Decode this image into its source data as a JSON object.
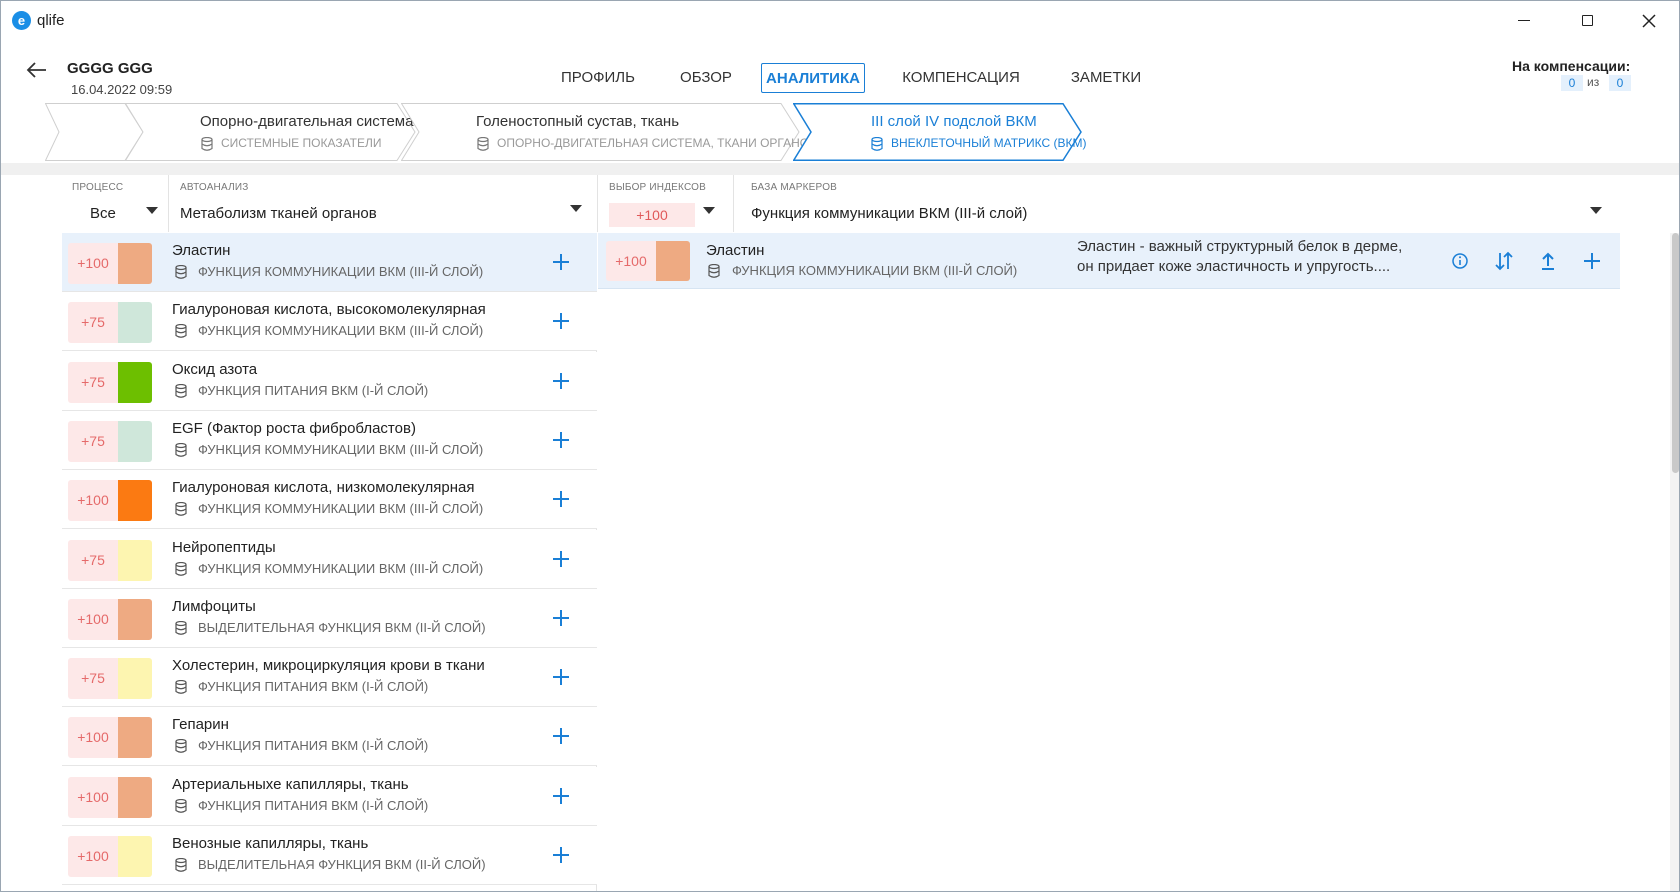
{
  "app": {
    "title": "qlife",
    "logo_glyph": "e"
  },
  "header": {
    "patient_name": "GGGG GGG",
    "patient_date": "16.04.2022 09:59",
    "tabs": [
      {
        "label": "ПРОФИЛЬ"
      },
      {
        "label": "ОБЗОР"
      },
      {
        "label": "АНАЛИТИКА",
        "active": true
      },
      {
        "label": "КОМПЕНСАЦИЯ"
      },
      {
        "label": "ЗАМЕТКИ"
      }
    ],
    "compensation": {
      "label": "На компенсации:",
      "current": "0",
      "of": "из",
      "total": "0"
    }
  },
  "breadcrumbs": [
    {
      "title": "",
      "subtitle": ""
    },
    {
      "title": "Опорно-двигательная система",
      "subtitle": "СИСТЕМНЫЕ ПОКАЗАТЕЛИ"
    },
    {
      "title": "Голеностопный сустав, ткань",
      "subtitle": "ОПОРНО-ДВИГАТЕЛЬНАЯ СИСТЕМА, ТКАНИ ОРГАНОВ"
    },
    {
      "title": "III слой IV подслой ВКМ",
      "subtitle": "ВНЕКЛЕТОЧНЫЙ МАТРИКС (ВКМ)",
      "active": true
    }
  ],
  "filters": {
    "process": {
      "label": "ПРОЦЕСС",
      "value": "Все"
    },
    "autoanalysis": {
      "label": "АВТОАНАЛИЗ",
      "value": "Метаболизм тканей органов"
    },
    "index_choice": {
      "label": "ВЫБОР ИНДЕКСОВ",
      "value": "+100"
    },
    "marker_base": {
      "label": "БАЗА МАРКЕРОВ",
      "value": "Функция коммуникации ВКМ (III-й слой)"
    }
  },
  "markers": [
    {
      "score": "+100",
      "color": "#eeaa82",
      "title": "Эластин",
      "subtitle": "ФУНКЦИЯ КОММУНИКАЦИИ ВКМ (III-Й СЛОЙ)",
      "selected": true
    },
    {
      "score": "+75",
      "color": "#cfe7da",
      "title": "Гиалуроновая кислота, высокомолекулярная",
      "subtitle": "ФУНКЦИЯ КОММУНИКАЦИИ ВКМ (III-Й СЛОЙ)"
    },
    {
      "score": "+75",
      "color": "#6dbf00",
      "title": "Оксид азота",
      "subtitle": "ФУНКЦИЯ ПИТАНИЯ ВКМ (I-Й СЛОЙ)"
    },
    {
      "score": "+75",
      "color": "#cfe7da",
      "title": "EGF (Фактор роста фибробластов)",
      "subtitle": "ФУНКЦИЯ КОММУНИКАЦИИ ВКМ (III-Й СЛОЙ)"
    },
    {
      "score": "+100",
      "color": "#fb7a12",
      "title": "Гиалуроновая кислота, низкомолекулярная",
      "subtitle": "ФУНКЦИЯ КОММУНИКАЦИИ ВКМ (III-Й СЛОЙ)"
    },
    {
      "score": "+75",
      "color": "#fdf5b0",
      "title": "Нейропептиды",
      "subtitle": "ФУНКЦИЯ КОММУНИКАЦИИ ВКМ (III-Й СЛОЙ)"
    },
    {
      "score": "+100",
      "color": "#eeaa82",
      "title": "Лимфоциты",
      "subtitle": "ВЫДЕЛИТЕЛЬНАЯ ФУНКЦИЯ ВКМ (II-Й СЛОЙ)"
    },
    {
      "score": "+75",
      "color": "#fdf5b0",
      "title": "Холестерин, микроциркуляция крови в ткани",
      "subtitle": "ФУНКЦИЯ ПИТАНИЯ ВКМ (I-Й СЛОЙ)"
    },
    {
      "score": "+100",
      "color": "#eeaa82",
      "title": "Гепарин",
      "subtitle": "ФУНКЦИЯ ПИТАНИЯ ВКМ (I-Й СЛОЙ)"
    },
    {
      "score": "+100",
      "color": "#eeaa82",
      "title": "Артериальныхе капилляры, ткань",
      "subtitle": "ФУНКЦИЯ ПИТАНИЯ ВКМ (I-Й СЛОЙ)"
    },
    {
      "score": "+100",
      "color": "#fdf5b0",
      "title": "Венозные капилляры, ткань",
      "subtitle": "ВЫДЕЛИТЕЛЬНАЯ ФУНКЦИЯ ВКМ (II-Й СЛОЙ)"
    }
  ],
  "selected_marker": {
    "score": "+100",
    "color": "#eeaa82",
    "title": "Эластин",
    "subtitle": "ФУНКЦИЯ КОММУНИКАЦИИ ВКМ (III-Й СЛОЙ)",
    "description": "Эластин - важный структурный белок в дерме, он придает коже эластичность и упругость...."
  },
  "colors": {
    "accent": "#1a7fd6",
    "score_bg": "#fde8e8",
    "score_text": "#e56a6a",
    "selected_bg": "#e8f1fb"
  },
  "icons": {
    "back": "arrow-left-icon",
    "database": "database-icon",
    "plus": "plus-icon",
    "info": "info-icon",
    "sort": "sort-icon",
    "upload": "upload-icon"
  }
}
